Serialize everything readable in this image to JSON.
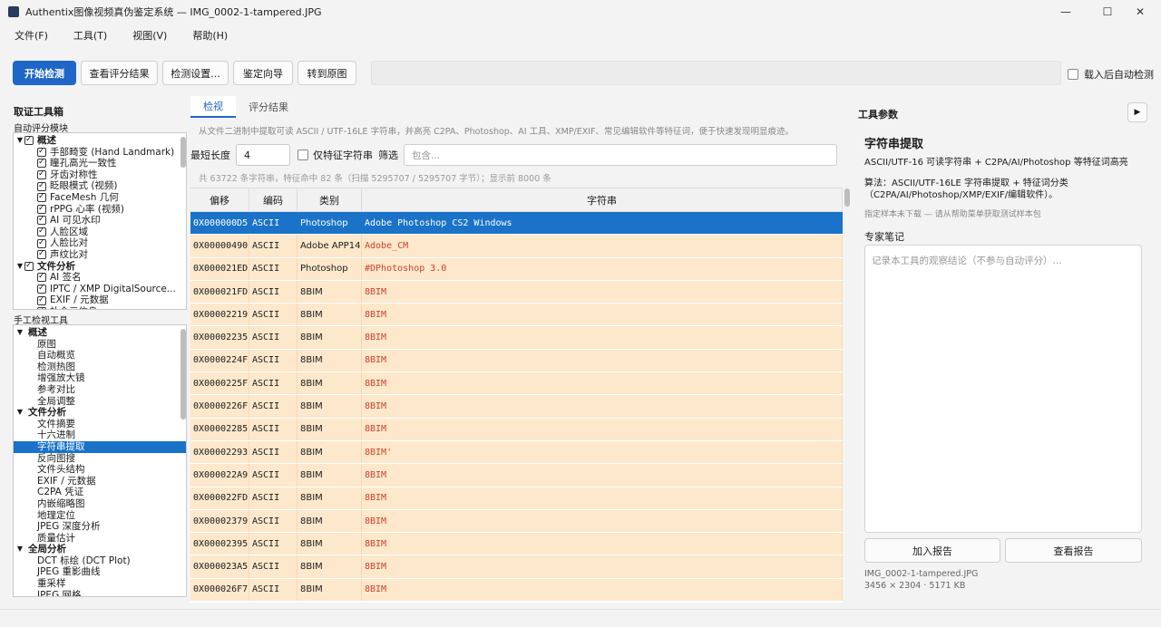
{
  "window": {
    "title": "Authentix图像视频真伪鉴定系统 — IMG_0002-1-tampered.JPG",
    "minimize": "—",
    "maximize": "☐",
    "close": "✕"
  },
  "menu": [
    "文件(F)",
    "工具(T)",
    "视图(V)",
    "帮助(H)"
  ],
  "toolbar": {
    "start": "开始检测",
    "view_scores": "查看评分结果",
    "settings": "检测设置...",
    "wizard": "鉴定向导",
    "goto_orig": "转到原图",
    "auto_detect": "载入后自动检测"
  },
  "left": {
    "title": "取证工具箱",
    "auto_section": "自动评分模块",
    "auto_tree": [
      {
        "label": "概述",
        "level": 0,
        "group": true,
        "checked": true
      },
      {
        "label": "手部畸变 (Hand Landmark)",
        "level": 1,
        "checked": true
      },
      {
        "label": "瞳孔高光一致性",
        "level": 1,
        "checked": true
      },
      {
        "label": "牙齿对称性",
        "level": 1,
        "checked": true
      },
      {
        "label": "眨眼模式 (视频)",
        "level": 1,
        "checked": true
      },
      {
        "label": "FaceMesh 几何",
        "level": 1,
        "checked": true
      },
      {
        "label": "rPPG 心率 (视频)",
        "level": 1,
        "checked": true
      },
      {
        "label": "AI 可见水印",
        "level": 1,
        "checked": true
      },
      {
        "label": "人脸区域",
        "level": 1,
        "checked": true
      },
      {
        "label": "人脸比对",
        "level": 1,
        "checked": true
      },
      {
        "label": "声纹比对",
        "level": 1,
        "checked": true
      },
      {
        "label": "文件分析",
        "level": 0,
        "group": true,
        "checked": true
      },
      {
        "label": "AI 签名",
        "level": 1,
        "checked": true
      },
      {
        "label": "IPTC / XMP DigitalSource...",
        "level": 1,
        "checked": true
      },
      {
        "label": "EXIF / 元数据",
        "level": 1,
        "checked": true
      },
      {
        "label": "补全元信息",
        "level": 1,
        "checked": true
      }
    ],
    "manual_section": "手工检视工具",
    "manual_tree": [
      {
        "label": "概述",
        "group": true
      },
      {
        "label": "原图"
      },
      {
        "label": "自动概览"
      },
      {
        "label": "检测热图"
      },
      {
        "label": "增强放大镜"
      },
      {
        "label": "参考对比"
      },
      {
        "label": "全局调整"
      },
      {
        "label": "文件分析",
        "group": true
      },
      {
        "label": "文件摘要"
      },
      {
        "label": "十六进制"
      },
      {
        "label": "字符串提取",
        "selected": true
      },
      {
        "label": "反向图搜"
      },
      {
        "label": "文件头结构"
      },
      {
        "label": "EXIF / 元数据"
      },
      {
        "label": "C2PA 凭证"
      },
      {
        "label": "内嵌缩略图"
      },
      {
        "label": "地理定位"
      },
      {
        "label": "JPEG 深度分析"
      },
      {
        "label": "质量估计"
      },
      {
        "label": "全局分析",
        "group": true
      },
      {
        "label": "DCT 标绘 (DCT Plot)"
      },
      {
        "label": "JPEG 重影曲线"
      },
      {
        "label": "重采样"
      },
      {
        "label": "JPEG 网格"
      }
    ]
  },
  "center": {
    "tabs": [
      "检视",
      "评分结果"
    ],
    "description": "从文件二进制中提取可读 ASCII / UTF-16LE 字符串，并高亮 C2PA、Photoshop、AI 工具、XMP/EXIF、常见编辑软件等特征词，便于快速发现明显痕迹。",
    "min_len_label": "最短长度",
    "min_len_value": "4",
    "only_feature_label": "仅特征字符串",
    "filter_label": "筛选",
    "filter_placeholder": "包含...",
    "stats": "共 63722 条字符串，特征命中 82 条（扫描 5295707 / 5295707 字节）；显示前 8000 条",
    "columns": [
      "偏移",
      "编码",
      "类别",
      "字符串"
    ],
    "rows": [
      {
        "offset": "0X000000D5",
        "enc": "ASCII",
        "cat": "Photoshop",
        "str": "Adobe Photoshop CS2 Windows",
        "selected": true
      },
      {
        "offset": "0X00000490",
        "enc": "ASCII",
        "cat": "Adobe APP14",
        "str": "Adobe_CM"
      },
      {
        "offset": "0X000021ED",
        "enc": "ASCII",
        "cat": "Photoshop",
        "str": "#DPhotoshop 3.0"
      },
      {
        "offset": "0X000021FD",
        "enc": "ASCII",
        "cat": "8BIM",
        "str": "8BIM"
      },
      {
        "offset": "0X00002219",
        "enc": "ASCII",
        "cat": "8BIM",
        "str": "8BIM"
      },
      {
        "offset": "0X00002235",
        "enc": "ASCII",
        "cat": "8BIM",
        "str": "8BIM"
      },
      {
        "offset": "0X0000224F",
        "enc": "ASCII",
        "cat": "8BIM",
        "str": "8BIM"
      },
      {
        "offset": "0X0000225F",
        "enc": "ASCII",
        "cat": "8BIM",
        "str": "8BIM"
      },
      {
        "offset": "0X0000226F",
        "enc": "ASCII",
        "cat": "8BIM",
        "str": "8BIM"
      },
      {
        "offset": "0X00002285",
        "enc": "ASCII",
        "cat": "8BIM",
        "str": "8BIM"
      },
      {
        "offset": "0X00002293",
        "enc": "ASCII",
        "cat": "8BIM",
        "str": "8BIM'"
      },
      {
        "offset": "0X000022A9",
        "enc": "ASCII",
        "cat": "8BIM",
        "str": "8BIM"
      },
      {
        "offset": "0X000022FD",
        "enc": "ASCII",
        "cat": "8BIM",
        "str": "8BIM"
      },
      {
        "offset": "0X00002379",
        "enc": "ASCII",
        "cat": "8BIM",
        "str": "8BIM"
      },
      {
        "offset": "0X00002395",
        "enc": "ASCII",
        "cat": "8BIM",
        "str": "8BIM"
      },
      {
        "offset": "0X000023A5",
        "enc": "ASCII",
        "cat": "8BIM",
        "str": "8BIM"
      },
      {
        "offset": "0X000026F7",
        "enc": "ASCII",
        "cat": "8BIM",
        "str": "8BIM"
      }
    ]
  },
  "right": {
    "title": "工具参数",
    "tool_name": "字符串提取",
    "tool_desc": "ASCII/UTF-16 可读字符串 + C2PA/AI/Photoshop 等特征词高亮",
    "algo": "算法：ASCII/UTF-16LE 字符串提取 + 特征词分类（C2PA/AI/Photoshop/XMP/EXIF/编辑软件）。",
    "hint": "指定样本未下载 — 请从帮助菜单获取测试样本包",
    "notes_label": "专家笔记",
    "notes_placeholder": "记录本工具的观察结论（不参与自动评分）...",
    "add_report": "加入报告",
    "view_report": "查看报告",
    "file_name": "IMG_0002-1-tampered.JPG",
    "file_info": "3456 × 2304 · 5171 KB"
  }
}
